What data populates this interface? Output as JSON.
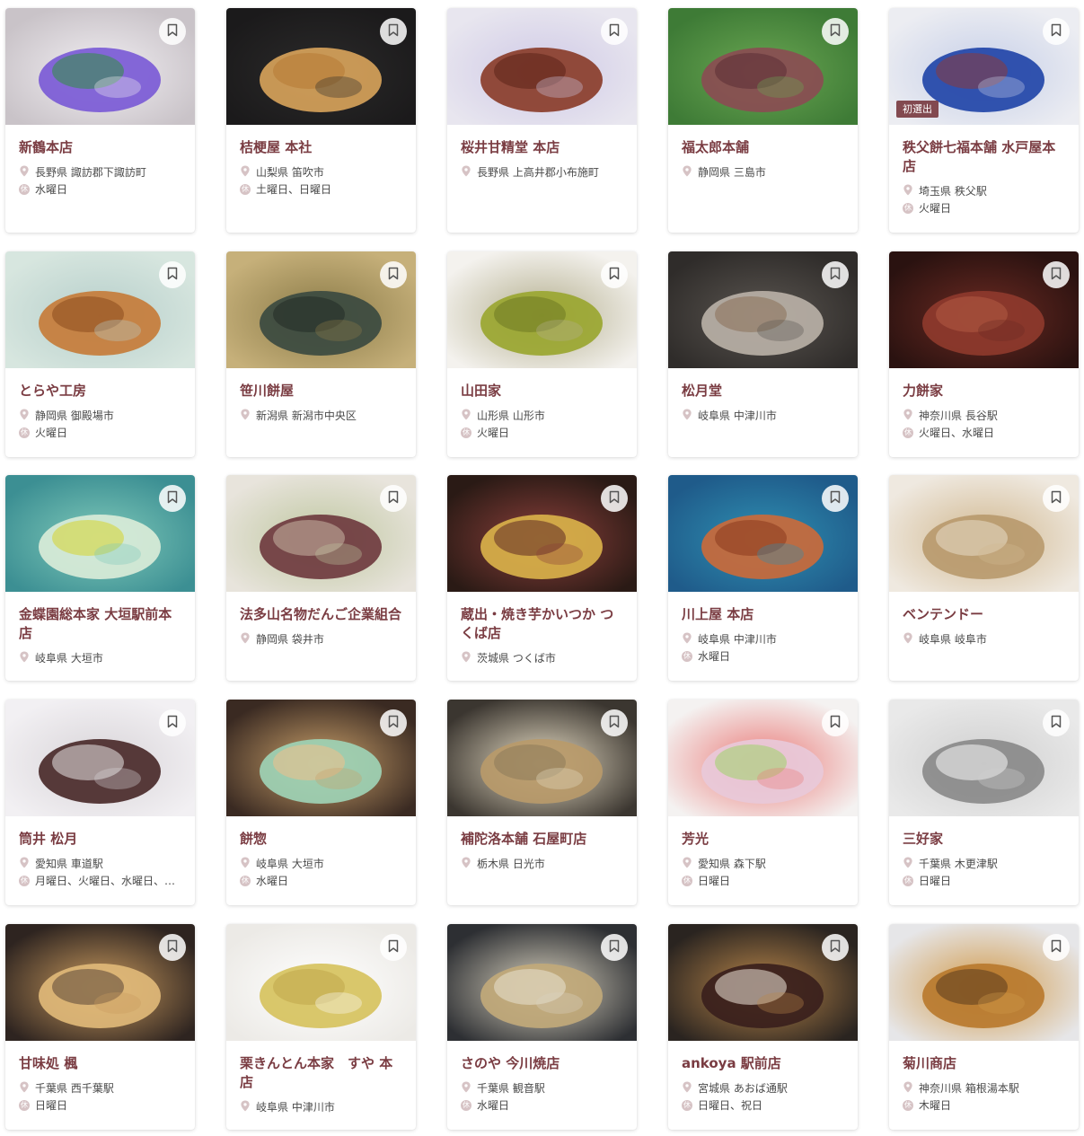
{
  "shops": [
    {
      "name": "新鶴本店",
      "area": "長野県 諏訪郡下諏訪町",
      "holiday": "水曜日",
      "photo": "purple-leaf-jelly-sweet"
    },
    {
      "name": "桔梗屋 本社",
      "area": "山梨県 笛吹市",
      "holiday": "土曜日、日曜日",
      "photo": "kinako-mochi"
    },
    {
      "name": "桜井甘精堂 本店",
      "area": "長野県 上高井郡小布施町",
      "holiday": "",
      "photo": "chestnut-manju"
    },
    {
      "name": "福太郎本舗",
      "area": "静岡県 三島市",
      "holiday": "",
      "photo": "green-mochi-rows"
    },
    {
      "name": "秩父餅七福本舗 水戸屋本店",
      "area": "埼玉県 秩父駅",
      "holiday": "火曜日",
      "badge": "初選出",
      "photo": "chichibu-mochi-pack"
    },
    {
      "name": "とらや工房",
      "area": "静岡県 御殿場市",
      "holiday": "火曜日",
      "photo": "dorayaki"
    },
    {
      "name": "笹川餅屋",
      "area": "新潟県 新潟市中央区",
      "holiday": "",
      "photo": "sasa-dango"
    },
    {
      "name": "山田家",
      "area": "山形県 山形市",
      "holiday": "火曜日",
      "photo": "furuki-mame"
    },
    {
      "name": "松月堂",
      "area": "岐阜県 中津川市",
      "holiday": "",
      "photo": "kuri-kinton"
    },
    {
      "name": "力餅家",
      "area": "神奈川県 長谷駅",
      "holiday": "火曜日、水曜日",
      "photo": "chikara-mochi"
    },
    {
      "name": "金蝶園総本家 大垣駅前本店",
      "area": "岐阜県 大垣市",
      "holiday": "",
      "photo": "water-jelly"
    },
    {
      "name": "法多山名物だんご企業組合",
      "area": "静岡県 袋井市",
      "holiday": "",
      "photo": "hattasan-dango"
    },
    {
      "name": "蔵出・焼き芋かいつか つくば店",
      "area": "茨城県 つくば市",
      "holiday": "",
      "photo": "yaki-imo"
    },
    {
      "name": "川上屋 本店",
      "area": "岐阜県 中津川市",
      "holiday": "水曜日",
      "photo": "kaki-wagashi"
    },
    {
      "name": "ベンテンドー",
      "area": "岐阜県 岐阜市",
      "holiday": "",
      "photo": "kinako-cookies"
    },
    {
      "name": "筒井 松月",
      "area": "愛知県 車道駅",
      "holiday": "月曜日、火曜日、水曜日、木曜日",
      "photo": "anko-mochi"
    },
    {
      "name": "餅惣",
      "area": "岐阜県 大垣市",
      "holiday": "水曜日",
      "photo": "mizu-manju"
    },
    {
      "name": "補陀洛本舗 石屋町店",
      "area": "栃木県 日光市",
      "holiday": "",
      "photo": "yuba-sweets"
    },
    {
      "name": "芳光",
      "area": "愛知県 森下駅",
      "holiday": "日曜日",
      "photo": "namagashi"
    },
    {
      "name": "三好家",
      "area": "千葉県 木更津駅",
      "holiday": "日曜日",
      "photo": "daifuku"
    },
    {
      "name": "甘味処 楓",
      "area": "千葉県 西千葉駅",
      "holiday": "日曜日",
      "photo": "kinako-warabi"
    },
    {
      "name": "栗きんとん本家　すや 本店",
      "area": "岐阜県 中津川市",
      "holiday": "",
      "photo": "suya-kinton"
    },
    {
      "name": "さのや 今川焼店",
      "area": "千葉県 観音駅",
      "holiday": "水曜日",
      "photo": "imagawayaki"
    },
    {
      "name": "ankoya 駅前店",
      "area": "宮城県 あおば通駅",
      "holiday": "日曜日、祝日",
      "photo": "anko-roll"
    },
    {
      "name": "菊川商店",
      "area": "神奈川県 箱根湯本駅",
      "holiday": "木曜日",
      "photo": "hakone-manju"
    }
  ],
  "labels": {
    "holiday_mark": "休"
  },
  "colors": {
    "accent": "#7a3c42",
    "pin": "#d6c3c5"
  }
}
